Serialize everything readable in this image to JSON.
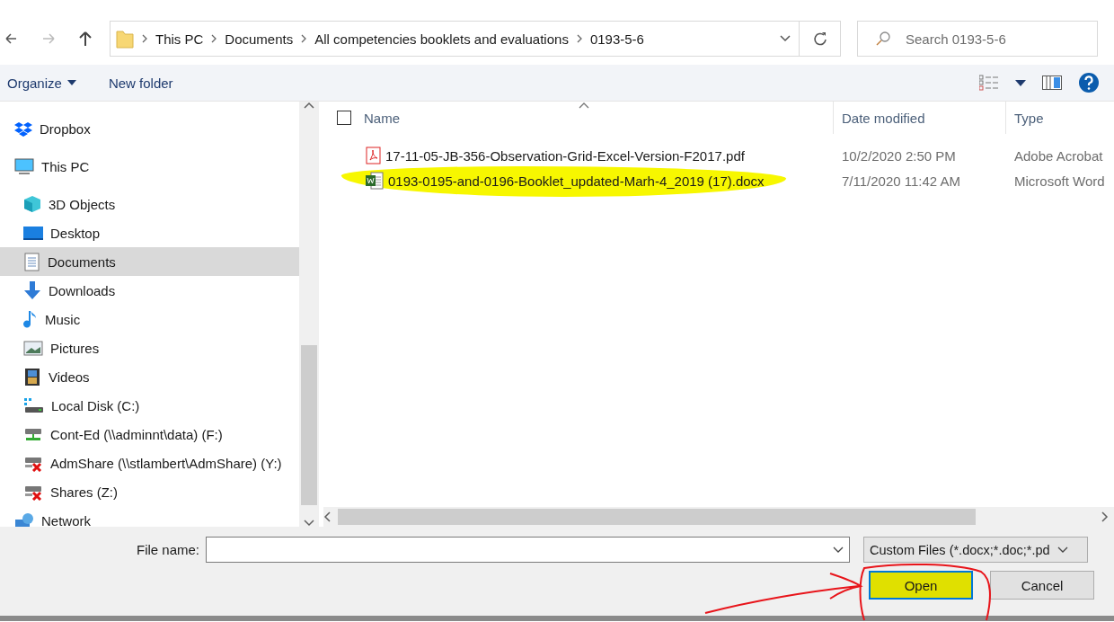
{
  "address_bar": {
    "path": [
      "This PC",
      "Documents",
      "All competencies booklets and evaluations",
      "0193-5-6"
    ]
  },
  "search": {
    "placeholder": "Search 0193-5-6"
  },
  "toolbar": {
    "organize": "Organize",
    "new_folder": "New folder"
  },
  "sidebar": {
    "items": [
      {
        "label": "Dropbox",
        "kind": "dropbox",
        "selected": false
      },
      {
        "label": "This PC",
        "kind": "pc",
        "selected": false,
        "children": [
          {
            "label": "3D Objects",
            "kind": "cube",
            "selected": false
          },
          {
            "label": "Desktop",
            "kind": "desktop",
            "selected": false
          },
          {
            "label": "Documents",
            "kind": "documents",
            "selected": true
          },
          {
            "label": "Downloads",
            "kind": "downloads",
            "selected": false
          },
          {
            "label": "Music",
            "kind": "music",
            "selected": false
          },
          {
            "label": "Pictures",
            "kind": "pictures",
            "selected": false
          },
          {
            "label": "Videos",
            "kind": "videos",
            "selected": false
          },
          {
            "label": "Local Disk (C:)",
            "kind": "disk",
            "selected": false
          },
          {
            "label": "Cont-Ed (\\\\adminnt\\data) (F:)",
            "kind": "netdrive",
            "selected": false
          },
          {
            "label": "AdmShare (\\\\stlambert\\AdmShare) (Y:)",
            "kind": "netdrive-off",
            "selected": false
          },
          {
            "label": "Shares (Z:)",
            "kind": "netdrive-off",
            "selected": false
          }
        ]
      },
      {
        "label": "Network",
        "kind": "network",
        "selected": false
      }
    ]
  },
  "table": {
    "select_all": {
      "checked": false
    },
    "columns": [
      "Name",
      "Date modified",
      "Type"
    ],
    "rows": [
      {
        "name": "17-11-05-JB-356-Observation-Grid-Excel-Version-F2017.pdf",
        "date": "10/2/2020 2:50 PM",
        "type": "Adobe Acrobat",
        "kind": "pdf",
        "highlighted": false
      },
      {
        "name": "0193-0195-and-0196-Booklet_updated-Marh-4_2019 (17).docx",
        "date": "7/11/2020 11:42 AM",
        "type": "Microsoft Word",
        "kind": "word",
        "highlighted": true
      }
    ]
  },
  "file_name": {
    "label": "File name:"
  },
  "file_type": {
    "value": "Custom Files (*.docx;*.doc;*.pd"
  },
  "buttons": [
    {
      "label": "Open",
      "default": true,
      "highlighted": true
    },
    {
      "label": "Cancel",
      "default": false,
      "highlighted": false
    }
  ]
}
